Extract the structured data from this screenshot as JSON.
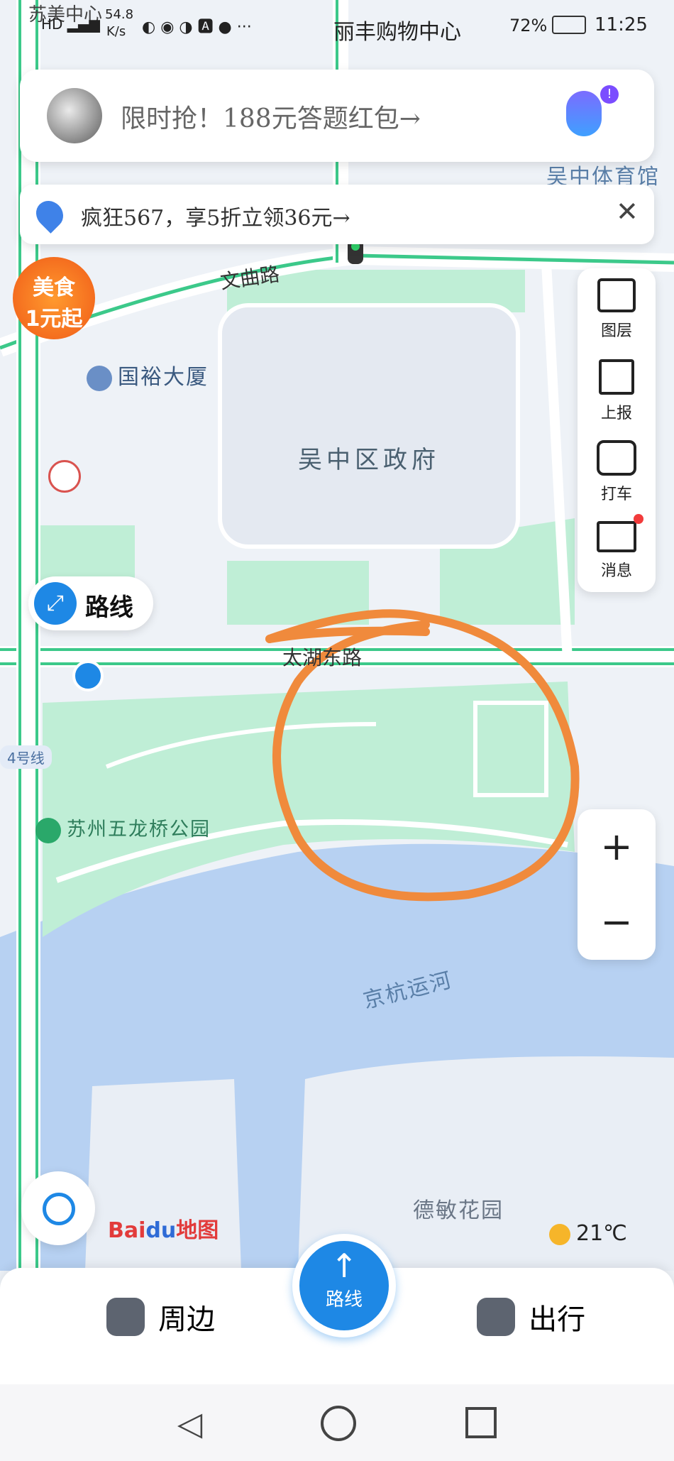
{
  "status_bar": {
    "carrier": "苏美中心",
    "net_speed": "54.8",
    "net_unit": "K/s",
    "center_text": "丽丰购物中心",
    "battery": "72%",
    "time": "11:25"
  },
  "search_card": {
    "promo_text": "限时抢！188元答题红包→"
  },
  "notice_card": {
    "text": "疯狂567，享5折立领36元→"
  },
  "badge": {
    "line1": "美食",
    "line2": "1元起"
  },
  "toolbar": {
    "items": [
      {
        "label": "图层",
        "icon": "layers-icon"
      },
      {
        "label": "上报",
        "icon": "report-icon"
      },
      {
        "label": "打车",
        "icon": "taxi-icon"
      },
      {
        "label": "消息",
        "icon": "message-icon"
      }
    ]
  },
  "map": {
    "roads": {
      "wenqu": "文曲路",
      "taihu_east": "太湖东路"
    },
    "pois": {
      "guoyu": "国裕大厦",
      "wuzhong_gov": "吴中区政府",
      "park": "苏州五龙桥公园",
      "canal": "京杭运河",
      "demin": "德敏花园",
      "stadium": "吴中体育馆",
      "metro_line": "4号线"
    },
    "route_chip": "路线",
    "logo_text": "地图",
    "logo_brand": "Bai",
    "weather_temp": "21℃"
  },
  "bottom_bar": {
    "nearby": "周边",
    "route": "路线",
    "travel": "出行"
  },
  "zoom": {
    "plus": "+",
    "minus": "−"
  },
  "colors": {
    "road_green": "#3cc98a",
    "water": "#a9c8ef",
    "park": "#bfeed6",
    "accent_blue": "#1e88e5",
    "annotation": "#f08a3c"
  }
}
